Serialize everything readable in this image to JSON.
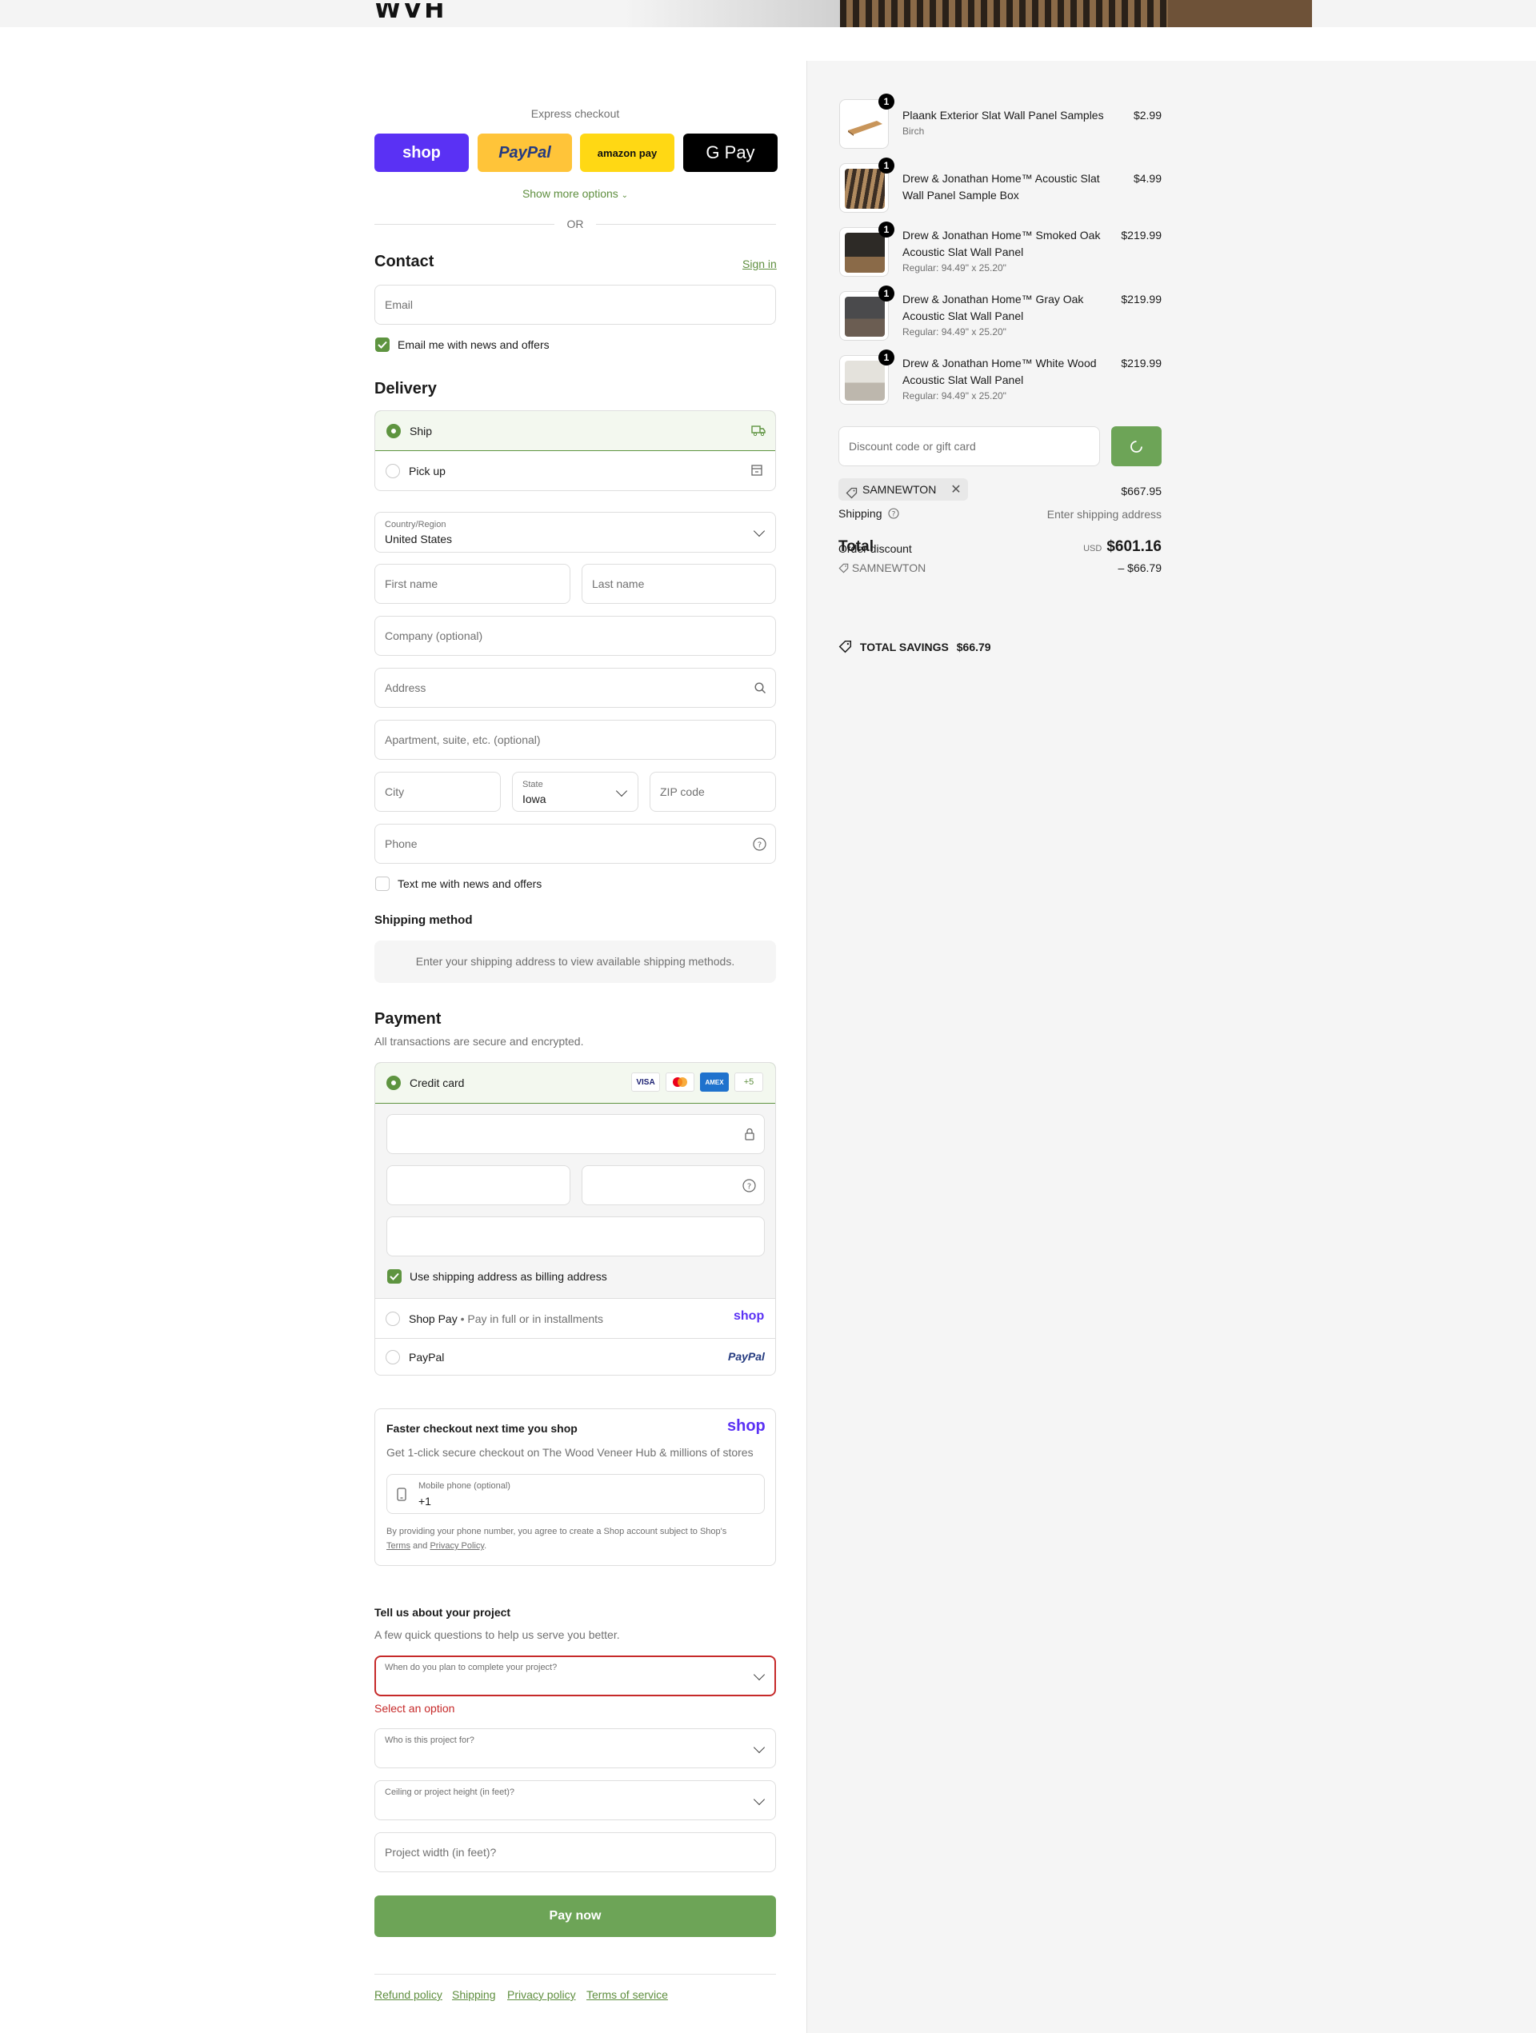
{
  "header": {
    "logo": "WVH"
  },
  "express": {
    "label": "Express checkout",
    "shop": "shop",
    "paypal": "PayPal",
    "amazon": "amazon pay",
    "gpay": "G Pay",
    "show_more": "Show more options",
    "or": "OR"
  },
  "contact": {
    "title": "Contact",
    "sign_in": "Sign in",
    "email_placeholder": "Email",
    "news_label": "Email me with news and offers"
  },
  "delivery": {
    "title": "Delivery",
    "ship": "Ship",
    "pickup": "Pick up",
    "country_label": "Country/Region",
    "country_value": "United States",
    "first_name": "First name",
    "last_name": "Last name",
    "company": "Company (optional)",
    "address": "Address",
    "apartment": "Apartment, suite, etc. (optional)",
    "city": "City",
    "state_label": "State",
    "state_value": "Iowa",
    "zip": "ZIP code",
    "phone": "Phone",
    "text_label": "Text me with news and offers"
  },
  "shipping_method": {
    "title": "Shipping method",
    "message": "Enter your shipping address to view available shipping methods."
  },
  "payment": {
    "title": "Payment",
    "subtitle": "All transactions are secure and encrypted.",
    "credit_card": "Credit card",
    "cards": [
      "VISA",
      "MC",
      "AMEX"
    ],
    "more_cards": "+5",
    "billing_label": "Use shipping address as billing address",
    "shop_pay": "Shop Pay",
    "shop_pay_sep": "•",
    "shop_pay_sub": "Pay in full or in installments",
    "shop_logo": "shop",
    "paypal": "PayPal",
    "paypal_logo": "PayPal"
  },
  "faster": {
    "title": "Faster checkout next time you shop",
    "logo": "shop",
    "desc": "Get 1-click secure checkout on The Wood Veneer Hub & millions of stores",
    "phone_label": "Mobile phone (optional)",
    "phone_value": "+1",
    "legal_1": "By providing your phone number, you agree to create a Shop account subject to Shop's",
    "terms": "Terms",
    "and": "and",
    "privacy": "Privacy Policy",
    "period": "."
  },
  "project": {
    "title": "Tell us about your project",
    "subtitle": "A few quick questions to help us serve you better.",
    "q1": "When do you plan to complete your project?",
    "error": "Select an option",
    "q2": "Who is this project for?",
    "q3": "Ceiling or project height (in feet)?",
    "q4": "Project width (in feet)?"
  },
  "pay_now": "Pay now",
  "footer": {
    "refund": "Refund policy",
    "shipping": "Shipping",
    "privacy": "Privacy policy",
    "terms": "Terms of service"
  },
  "summary": {
    "items": [
      {
        "qty": "1",
        "title": "Plaank Exterior Slat Wall Panel Samples",
        "sub": "Birch",
        "price": "$2.99"
      },
      {
        "qty": "1",
        "title": "Drew & Jonathan Home™ Acoustic Slat Wall Panel Sample Box",
        "sub": "",
        "price": "$4.99"
      },
      {
        "qty": "1",
        "title": "Drew & Jonathan Home™ Smoked Oak Acoustic Slat Wall Panel",
        "sub": "Regular: 94.49\" x 25.20\"",
        "price": "$219.99"
      },
      {
        "qty": "1",
        "title": "Drew & Jonathan Home™ Gray Oak Acoustic Slat Wall Panel",
        "sub": "Regular: 94.49\" x 25.20\"",
        "price": "$219.99"
      },
      {
        "qty": "1",
        "title": "Drew & Jonathan Home™ White Wood Acoustic Slat Wall Panel",
        "sub": "Regular: 94.49\" x 25.20\"",
        "price": "$219.99"
      }
    ],
    "discount_placeholder": "Discount code or gift card",
    "code": "SAMNEWTON",
    "subtotal": "$667.95",
    "shipping_label": "Shipping",
    "shipping_value": "Enter shipping address",
    "total_label": "Total",
    "total_overlap": "Order discount",
    "currency": "USD",
    "total": "$601.16",
    "discount_code": "SAMNEWTON",
    "discount_value": "– $66.79",
    "savings_label": "TOTAL SAVINGS",
    "savings_value": "$66.79"
  }
}
